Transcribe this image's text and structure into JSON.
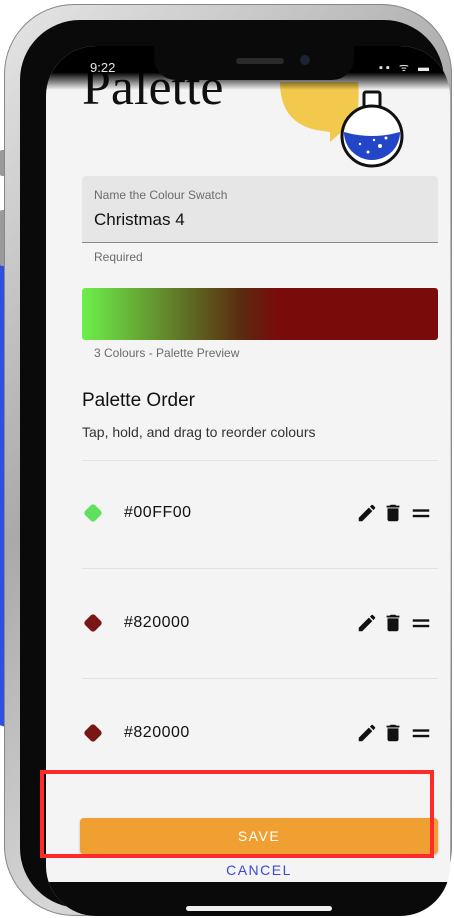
{
  "status_bar": {
    "time": "9:22",
    "icons": "▪▪ ᯤ ▬"
  },
  "header": {
    "title": "Palette"
  },
  "name_field": {
    "label": "Name the Colour Swatch",
    "value": "Christmas 4",
    "helper": "Required"
  },
  "preview": {
    "caption": "3 Colours - Palette Preview",
    "gradient_colors": [
      "#6cf04a",
      "#5a2a10",
      "#7a0b0b"
    ]
  },
  "palette_order": {
    "title": "Palette Order",
    "subtitle": "Tap, hold, and drag to reorder colours",
    "items": [
      {
        "hex": "#00FF00",
        "swatch": "#5fe05f"
      },
      {
        "hex": "#820000",
        "swatch": "#7a1616"
      },
      {
        "hex": "#820000",
        "swatch": "#7a1616"
      }
    ]
  },
  "actions": {
    "save_label": "SAVE",
    "cancel_label": "CANCEL"
  },
  "colors": {
    "accent": "#f0a033",
    "cancel": "#3a49d6",
    "highlight": "#ff2a2a"
  }
}
